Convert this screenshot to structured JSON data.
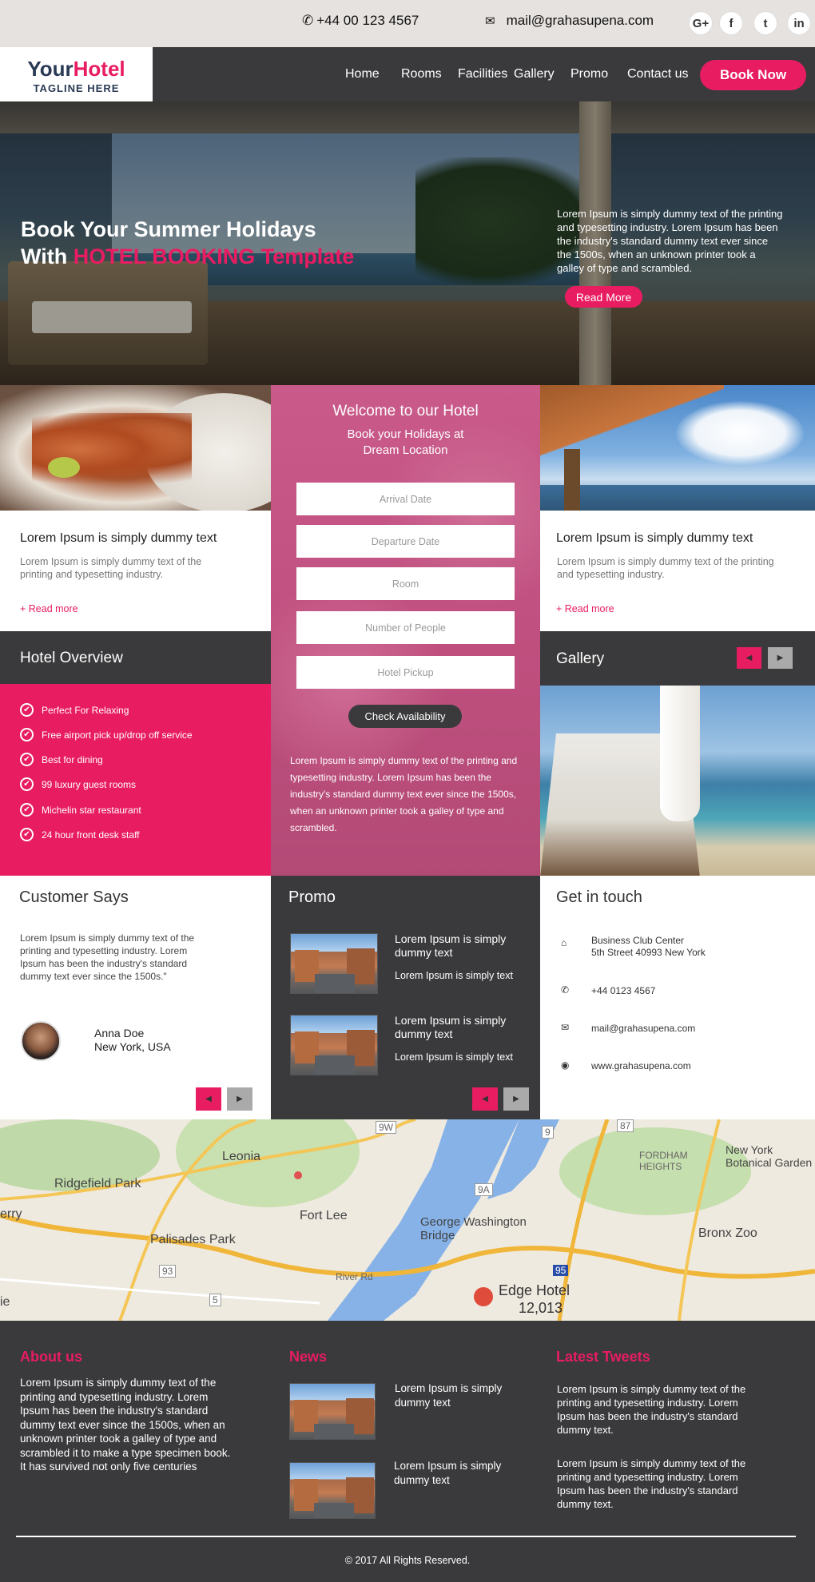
{
  "topbar": {
    "phone": "+44 00 123 4567",
    "email": "mail@grahasupena.com",
    "social": [
      "G+",
      "f",
      "t",
      "in"
    ]
  },
  "brand": {
    "name_part1": "Your",
    "name_part2": "Hotel",
    "tagline": "TAGLINE HERE"
  },
  "nav": {
    "items": [
      "Home",
      "Rooms",
      "Facilities",
      "Gallery",
      "Promo",
      "Contact us"
    ],
    "cta": "Book Now"
  },
  "hero": {
    "line1": "Book Your Summer Holidays",
    "line2_prefix": "With ",
    "line2_highlight": "HOTEL BOOKING Template",
    "text": "Lorem Ipsum is simply dummy text of the printing and typesetting industry. Lorem Ipsum has been the industry's standard dummy text ever since the 1500s, when an unknown printer took a galley of type and scrambled.",
    "button": "Read More"
  },
  "cards": [
    {
      "title": "Lorem Ipsum is simply dummy text",
      "text": "Lorem Ipsum is simply dummy text of the printing and typesetting industry.",
      "link": "+ Read more"
    },
    {
      "title": "Lorem Ipsum is simply dummy text",
      "text": "Lorem Ipsum is simply dummy text of the printing and typesetting industry.",
      "link": "+ Read more"
    }
  ],
  "booking": {
    "title": "Welcome to our Hotel",
    "subtitle_line1": "Book your Holidays at",
    "subtitle_line2": "Dream Location",
    "fields": [
      "Arrival Date",
      "Departure Date",
      "Room",
      "Number of People",
      "Hotel Pickup"
    ],
    "button": "Check Availability",
    "text": "Lorem Ipsum is simply dummy text of the printing and typesetting industry. Lorem Ipsum has been the industry's standard dummy text ever since the 1500s, when an unknown printer took a galley of type and scrambled."
  },
  "overview": {
    "title": "Hotel Overview",
    "items": [
      "Perfect For Relaxing",
      "Free airport pick up/drop off service",
      "Best for dining",
      "99 luxury guest rooms",
      "Michelin star restaurant",
      "24 hour front desk staff"
    ]
  },
  "gallery": {
    "title": "Gallery"
  },
  "customer": {
    "title": "Customer Says",
    "quote": "Lorem Ipsum is simply dummy text of the printing and typesetting industry. Lorem Ipsum has been the industry's standard dummy text ever since the 1500s.\"",
    "name": "Anna Doe",
    "location": "New York, USA"
  },
  "promo": {
    "title": "Promo",
    "items": [
      {
        "title": "Lorem Ipsum is simply dummy text",
        "sub": "Lorem Ipsum is simply text"
      },
      {
        "title": "Lorem Ipsum is simply dummy text",
        "sub": "Lorem Ipsum is simply text"
      }
    ]
  },
  "contact": {
    "title": "Get in touch",
    "address_line1": "Business Club Center",
    "address_line2": "5th Street 40993 New York",
    "phone": "+44 0123 4567",
    "email": "mail@grahasupena.com",
    "web": "www.grahasupena.com"
  },
  "map": {
    "labels": [
      "Ridgefield Park",
      "Leonia",
      "Palisades Park",
      "Fort Lee",
      "George Washington Bridge",
      "Edge Hotel",
      "12,013",
      "New York Botanical Garden",
      "Bronx Zoo",
      "FORDHAM HEIGHTS",
      "River Rd",
      "erry",
      "ie"
    ],
    "shields": [
      "9W",
      "9",
      "87",
      "9A",
      "95",
      "93",
      "5"
    ]
  },
  "footer": {
    "about_title": "About us",
    "about_text": "Lorem Ipsum is simply dummy text of the printing and typesetting industry. Lorem Ipsum has been the industry's standard dummy text ever since the 1500s, when an unknown printer took a galley of type and scrambled it to make a type specimen book. It has survived not only five centuries",
    "news_title": "News",
    "news_items": [
      "Lorem Ipsum is simply dummy text",
      "Lorem Ipsum is simply dummy text"
    ],
    "tweets_title": "Latest Tweets",
    "tweets": [
      "Lorem Ipsum is simply dummy text of the printing and typesetting industry. Lorem Ipsum has been the industry's standard dummy text.",
      "Lorem Ipsum is simply dummy text of the printing and typesetting industry. Lorem Ipsum has been the industry's standard dummy text."
    ],
    "copyright": "© 2017 All Rights Reserved."
  },
  "colors": {
    "accent": "#e81c61",
    "dark": "#3a3a3c",
    "topbar": "#e6e2df",
    "booking_panel": "#c0507f"
  }
}
